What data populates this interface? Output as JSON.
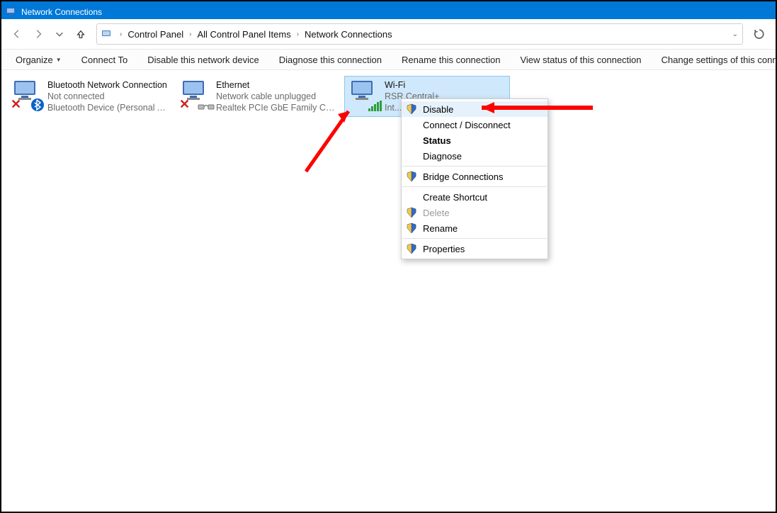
{
  "titlebar": {
    "title": "Network Connections"
  },
  "breadcrumb": {
    "items": [
      "Control Panel",
      "All Control Panel Items",
      "Network Connections"
    ]
  },
  "cmdbar": {
    "organize": "Organize",
    "connect_to": "Connect To",
    "disable": "Disable this network device",
    "diagnose": "Diagnose this connection",
    "rename": "Rename this connection",
    "view_status": "View status of this connection",
    "change_settings": "Change settings of this connection"
  },
  "connections": {
    "bt": {
      "name": "Bluetooth Network Connection",
      "status": "Not connected",
      "device": "Bluetooth Device (Personal Area ..."
    },
    "eth": {
      "name": "Ethernet",
      "status": "Network cable unplugged",
      "device": "Realtek PCIe GbE Family Controller"
    },
    "wifi": {
      "name": "Wi-Fi",
      "status": "RSR Central+",
      "device": "Int..."
    }
  },
  "ctx": {
    "disable": "Disable",
    "connect": "Connect / Disconnect",
    "status": "Status",
    "diagnose": "Diagnose",
    "bridge": "Bridge Connections",
    "create_shortcut": "Create Shortcut",
    "delete": "Delete",
    "rename": "Rename",
    "properties": "Properties"
  }
}
